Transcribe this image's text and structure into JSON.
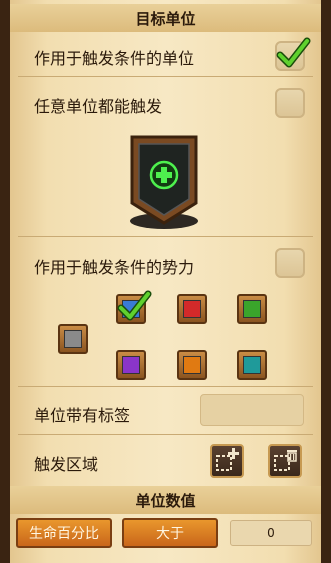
{
  "target_unit": {
    "title": "目标单位",
    "affected_unit_label": "作用于触发条件的单位",
    "affected_unit_checked": true,
    "any_unit_label": "任意单位都能触发",
    "any_unit_checked": false,
    "unit_slot_icon": "green-plus-icon"
  },
  "force": {
    "label": "作用于触发条件的势力",
    "checked": false,
    "colors": [
      {
        "name": "gray",
        "hex": "#8a8a8a",
        "checked": false
      },
      {
        "name": "blue",
        "hex": "#3a7bd5",
        "checked": true
      },
      {
        "name": "red",
        "hex": "#d32a2a",
        "checked": false
      },
      {
        "name": "green",
        "hex": "#3aa52b",
        "checked": false
      },
      {
        "name": "purple",
        "hex": "#8a35c9",
        "checked": false
      },
      {
        "name": "orange",
        "hex": "#e07a12",
        "checked": false
      },
      {
        "name": "teal",
        "hex": "#1f9a9a",
        "checked": false
      }
    ]
  },
  "tag": {
    "label": "单位带有标签",
    "value": ""
  },
  "zone": {
    "label": "触发区域",
    "add_icon": "add-region-icon",
    "delete_icon": "delete-region-icon"
  },
  "unit_value": {
    "title": "单位数值",
    "stat_button": "生命百分比",
    "compare_button": "大于",
    "value": "0"
  }
}
